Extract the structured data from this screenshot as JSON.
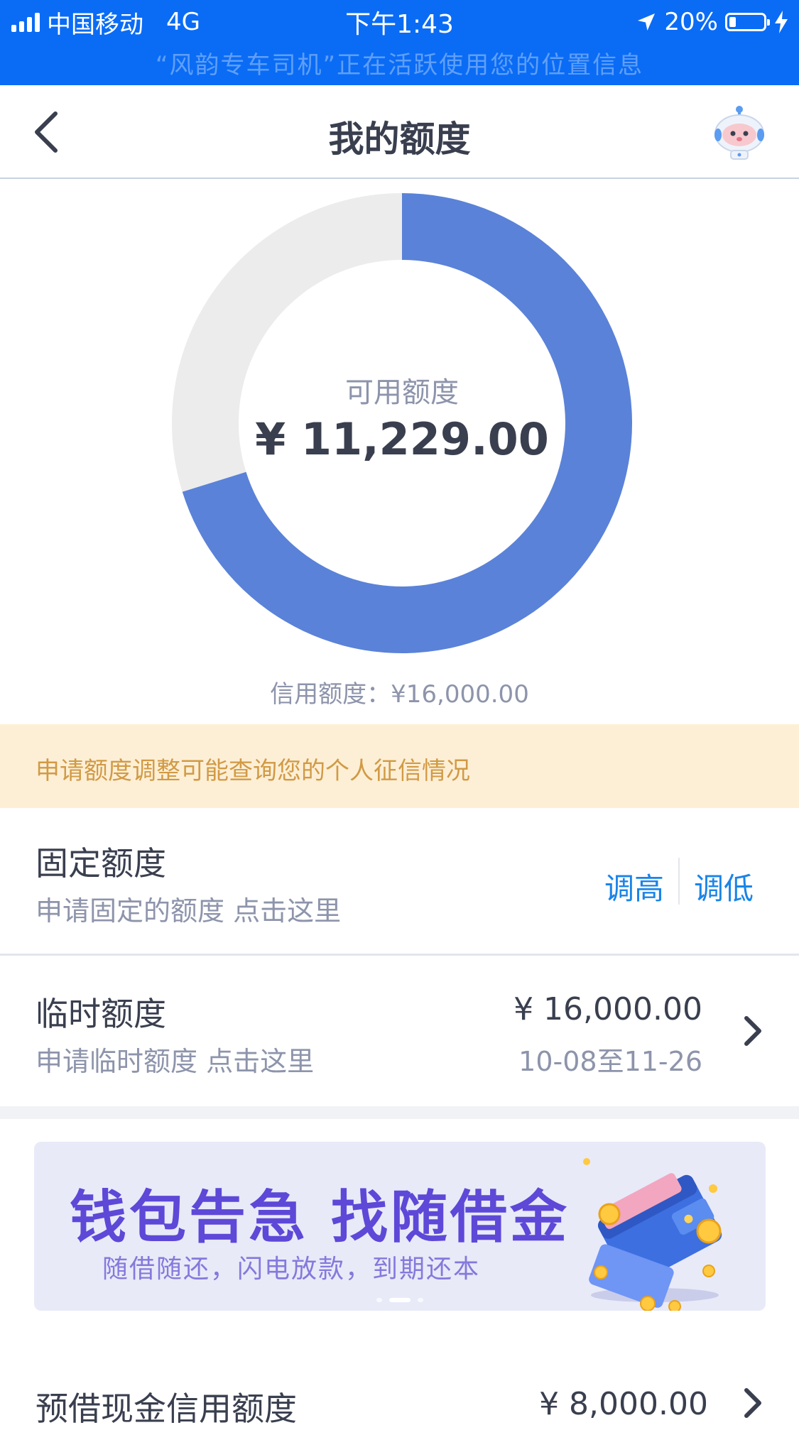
{
  "status_bar": {
    "carrier": "中国移动",
    "network": "4G",
    "time": "下午1:43",
    "battery": "20%",
    "battery_level": 0.2,
    "location_banner": "“风韵专车司机”正在活跃使用您的位置信息"
  },
  "nav": {
    "title": "我的额度"
  },
  "quota_chart": {
    "center_label": "可用额度",
    "center_value": "¥ 11,229.00",
    "credit_line": "信用额度：¥16,000.00"
  },
  "chart_data": {
    "type": "pie",
    "total": 16000,
    "slices": [
      {
        "value": 11229,
        "color": "#5a82d8"
      },
      {
        "value": 4771,
        "color": "#ececec"
      }
    ]
  },
  "notice": {
    "text": "申请额度调整可能查询您的个人征信情况"
  },
  "fixed_quota": {
    "title": "固定额度",
    "subtitle": "申请固定的额度 点击这里",
    "raise_label": "调高",
    "lower_label": "调低"
  },
  "temp_quota": {
    "title": "临时额度",
    "subtitle": "申请临时额度 点击这里",
    "amount": "¥ 16,000.00",
    "period": "10-08至11-26"
  },
  "banner": {
    "headline": "钱包告急 找随借金",
    "subline": "随借随还，闪电放款，到期还本"
  },
  "cash_quota": {
    "title": "预借现金信用额度",
    "amount": "¥ 8,000.00"
  },
  "colors": {
    "status_bar": "#0a6cf5",
    "accent": "#1a84e8",
    "used": "#5a82d8",
    "notice_bg": "#fdefd6",
    "notice_text": "#d19a45"
  }
}
